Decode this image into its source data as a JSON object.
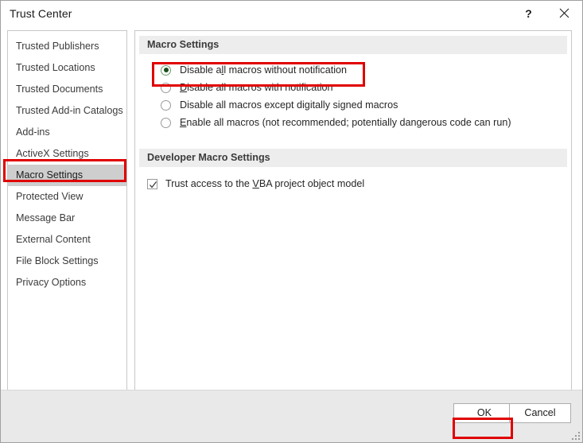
{
  "window": {
    "title": "Trust Center",
    "help_icon": "question-mark-icon",
    "close_icon": "close-icon"
  },
  "sidebar": {
    "items": [
      {
        "label": "Trusted Publishers",
        "selected": false
      },
      {
        "label": "Trusted Locations",
        "selected": false
      },
      {
        "label": "Trusted Documents",
        "selected": false
      },
      {
        "label": "Trusted Add-in Catalogs",
        "selected": false
      },
      {
        "label": "Add-ins",
        "selected": false
      },
      {
        "label": "ActiveX Settings",
        "selected": false
      },
      {
        "label": "Macro Settings",
        "selected": true
      },
      {
        "label": "Protected View",
        "selected": false
      },
      {
        "label": "Message Bar",
        "selected": false
      },
      {
        "label": "External Content",
        "selected": false
      },
      {
        "label": "File Block Settings",
        "selected": false
      },
      {
        "label": "Privacy Options",
        "selected": false
      }
    ]
  },
  "main": {
    "macro_settings": {
      "heading": "Macro Settings",
      "options": [
        {
          "label": "Disable all macros without notification",
          "pre": "Disable a",
          "accel": "l",
          "post": "l macros without notification",
          "checked": true
        },
        {
          "label": "Disable all macros with notification",
          "pre": "",
          "accel": "D",
          "post": "isable all macros with notification",
          "checked": false
        },
        {
          "label": "Disable all macros except digitally signed macros",
          "pre": "Disable all macros except di",
          "accel": "g",
          "post": "itally signed macros",
          "checked": false
        },
        {
          "label": "Enable all macros (not recommended; potentially dangerous code can run)",
          "pre": "",
          "accel": "E",
          "post": "nable all macros (not recommended; potentially dangerous code can run)",
          "checked": false
        }
      ]
    },
    "developer_macro_settings": {
      "heading": "Developer Macro Settings",
      "checkbox": {
        "label": "Trust access to the VBA project object model",
        "pre": "Trust access to the ",
        "accel": "V",
        "post": "BA project object model",
        "checked": true
      }
    }
  },
  "footer": {
    "ok_label": "OK",
    "cancel_label": "Cancel"
  },
  "annotations": {
    "color": "#e00000",
    "boxes": [
      "sidebar-macro-settings",
      "radio-disable-all-without-notification",
      "ok-button"
    ]
  }
}
